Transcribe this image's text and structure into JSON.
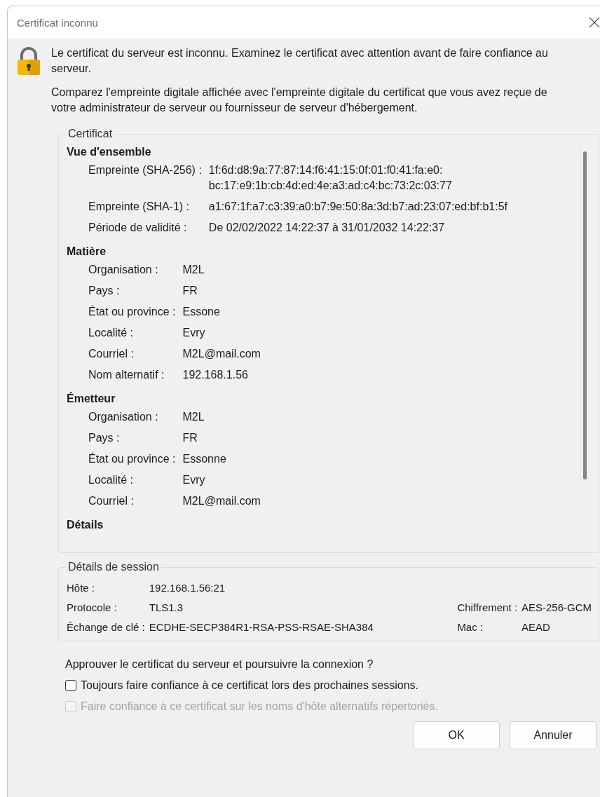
{
  "window": {
    "title": "Certificat inconnu"
  },
  "messages": [
    "Le certificat du serveur est inconnu. Examinez le certificat avec attention avant de faire confiance au serveur.",
    "Comparez l'empreinte digitale affichée avec l'empreinte digitale du certificat que vous avez reçue de votre administrateur de serveur ou fournisseur de serveur d'hébergement."
  ],
  "certificate": {
    "title": "Certificat",
    "sections": [
      {
        "heading": "Vue d'ensemble",
        "rows": [
          {
            "label": "Empreinte (SHA-256) :",
            "lines": [
              "1f:6d:d8:9a:77:87:14:f6:41:15:0f:01:f0:41:fa:e0:",
              "bc:17:e9:1b:cb:4d:ed:4e:a3:ad:c4:bc:73:2c:03:77"
            ]
          },
          {
            "label": "Empreinte (SHA-1) :",
            "lines": [
              "a1:67:1f:a7:c3:39:a0:b7:9e:50:8a:3d:b7:ad:23:07:ed:bf:b1:5f"
            ]
          },
          {
            "label": "Période de validité :",
            "lines": [
              "De 02/02/2022 14:22:37 à 31/01/2032 14:22:37"
            ]
          }
        ]
      },
      {
        "heading": "Matière",
        "rows": [
          {
            "label": "Organisation :",
            "lines": [
              "M2L"
            ]
          },
          {
            "label": "Pays :",
            "lines": [
              "FR"
            ]
          },
          {
            "label": "État ou province :",
            "lines": [
              "Essone"
            ]
          },
          {
            "label": "Localité :",
            "lines": [
              "Evry"
            ]
          },
          {
            "label": "Courriel :",
            "lines": [
              "M2L@mail.com"
            ]
          },
          {
            "label": "Nom alternatif :",
            "lines": [
              "192.168.1.56"
            ]
          }
        ]
      },
      {
        "heading": "Émetteur",
        "rows": [
          {
            "label": "Organisation :",
            "lines": [
              "M2L"
            ]
          },
          {
            "label": "Pays :",
            "lines": [
              "FR"
            ]
          },
          {
            "label": "État ou province :",
            "lines": [
              "Essonne"
            ]
          },
          {
            "label": "Localité :",
            "lines": [
              "Evry"
            ]
          },
          {
            "label": "Courriel :",
            "lines": [
              "M2L@mail.com"
            ]
          }
        ]
      },
      {
        "heading": "Détails"
      }
    ]
  },
  "session": {
    "title": "Détails de session",
    "rows": [
      [
        {
          "label": "Hôte :",
          "value": "192.168.1.56:21"
        }
      ],
      [
        {
          "label": "Protocole :",
          "value": "TLS1.3"
        },
        {
          "label": "Chiffrement :",
          "value": "AES-256-GCM"
        }
      ],
      [
        {
          "label": "Échange de clé :",
          "value": "ECDHE-SECP384R1-RSA-PSS-RSAE-SHA384"
        },
        {
          "label": "Mac :",
          "value": "AEAD"
        }
      ]
    ]
  },
  "question": "Approuver le certificat du serveur et poursuivre la connexion ?",
  "options": [
    {
      "label": "Toujours faire confiance à ce certificat lors des prochaines sessions.",
      "checked": false,
      "disabled": false
    },
    {
      "label": "Faire confiance à ce certificat sur les noms d'hôte alternatifs répertoriés.",
      "checked": false,
      "disabled": true
    }
  ],
  "buttons": [
    "OK",
    "Annuler"
  ]
}
